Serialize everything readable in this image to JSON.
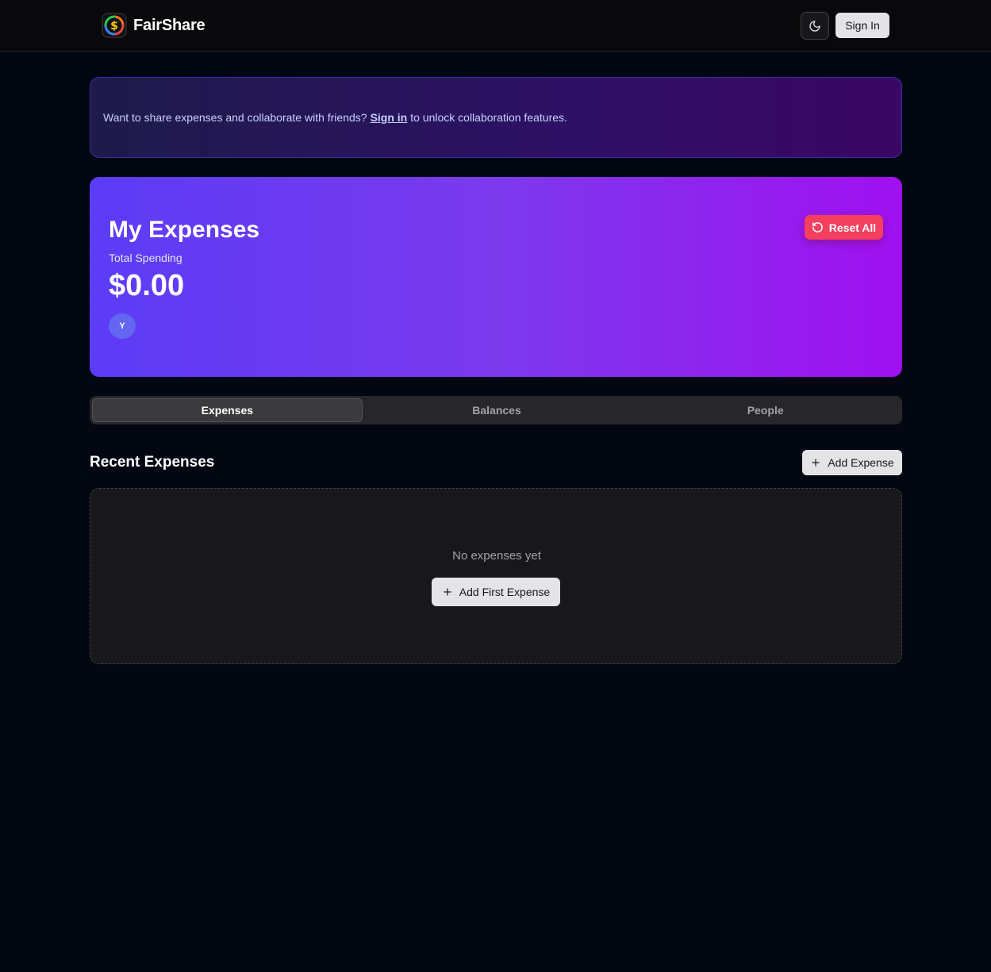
{
  "header": {
    "brand_name": "FairShare",
    "logo_icon": "dollar-cycle-icon",
    "theme_toggle_icon": "moon-icon",
    "signin_label": "Sign In"
  },
  "banner": {
    "text_before": "Want to share expenses and collaborate with friends?",
    "link_label": "Sign in",
    "text_after": "to unlock collaboration features."
  },
  "hero": {
    "title": "My Expenses",
    "subtitle": "Total Spending",
    "amount": "$0.00",
    "avatar_initial": "Y",
    "reset_label": "Reset All",
    "reset_icon": "rotate-ccw-icon",
    "gradient_start": "#5b3cf6",
    "gradient_end": "#a010f0"
  },
  "tabs": [
    {
      "label": "Expenses",
      "active": true
    },
    {
      "label": "Balances",
      "active": false
    },
    {
      "label": "People",
      "active": false
    }
  ],
  "recent": {
    "title": "Recent Expenses",
    "add_label": "Add Expense",
    "add_icon": "plus-icon",
    "empty_text": "No expenses yet",
    "add_first_label": "Add First Expense"
  },
  "colors": {
    "background": "#030712",
    "reset_button": "#f43f5e",
    "light_button": "#e4e4e7"
  }
}
